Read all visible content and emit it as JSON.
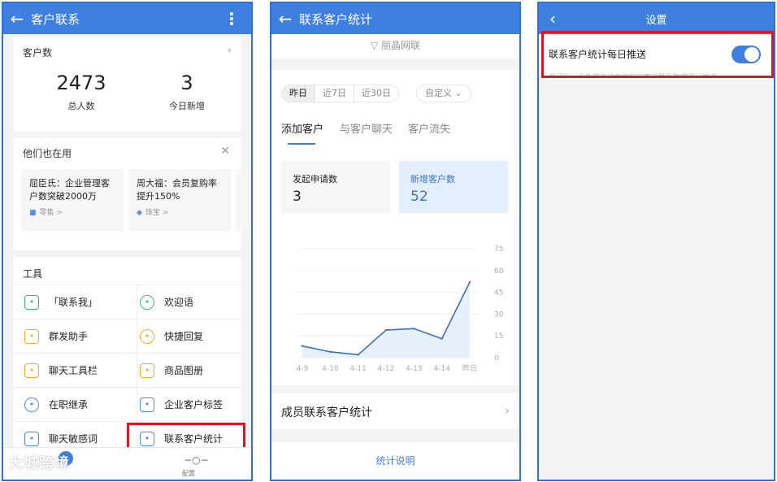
{
  "screen1": {
    "title": "客户联系",
    "customer_count": {
      "header": "客户数",
      "total_value": "2473",
      "total_label": "总人数",
      "new_value": "3",
      "new_label": "今日新增"
    },
    "also_using": {
      "header": "他们也在用",
      "cases": [
        {
          "text": "屈臣氏：企业管理客户数突破2000万",
          "tag": "零售 >"
        },
        {
          "text": "周大福：会员复购率提升150%",
          "tag": "珠宝 >"
        }
      ]
    },
    "tools": {
      "header": "工具",
      "items": [
        {
          "label": "「联系我」",
          "icon": "chat-icon"
        },
        {
          "label": "欢迎语",
          "icon": "hi-icon"
        },
        {
          "label": "群发助手",
          "icon": "megaphone-icon"
        },
        {
          "label": "快捷回复",
          "icon": "quick-reply-icon"
        },
        {
          "label": "聊天工具栏",
          "icon": "toolbar-icon"
        },
        {
          "label": "商品图册",
          "icon": "catalog-icon"
        },
        {
          "label": "在职继承",
          "icon": "transfer-icon"
        },
        {
          "label": "企业客户标签",
          "icon": "tag-icon"
        },
        {
          "label": "聊天敏感词",
          "icon": "sensitive-word-icon"
        },
        {
          "label": "联系客户统计",
          "icon": "statistics-icon"
        }
      ]
    },
    "tabbar": {
      "config_label": "配置"
    },
    "watermark": "大城跨境"
  },
  "screen2": {
    "title": "联系客户统计",
    "filter_label": "丽晶网联",
    "periods": [
      "昨日",
      "近7日",
      "近30日"
    ],
    "custom_label": "自定义",
    "tabs": [
      "添加客户",
      "与客户聊天",
      "客户流失"
    ],
    "metrics": [
      {
        "label": "发起申请数",
        "value": "3"
      },
      {
        "label": "新增客户数",
        "value": "52"
      }
    ],
    "member_stats_label": "成员联系客户统计",
    "explain_label": "统计说明"
  },
  "chart_data": {
    "type": "area",
    "categories": [
      "4-9",
      "4-10",
      "4-11",
      "4-12",
      "4-13",
      "4-14",
      "昨日"
    ],
    "values": [
      8,
      4,
      2,
      19,
      20,
      13,
      52
    ],
    "yticks": [
      0,
      15,
      30,
      45,
      60,
      75
    ],
    "ylim": [
      0,
      75
    ],
    "grid": true,
    "color": "#3a72b8",
    "fill": "#e8f0fb"
  },
  "screen3": {
    "title": "设置",
    "setting_label": "联系客户统计每日推送",
    "setting_desc": "关闭后，企业将无法收到每日客户联系数据统计推送",
    "toggle_on": true
  },
  "colors": {
    "accent": "#3f7fe0",
    "highlight": "#e0141e"
  }
}
